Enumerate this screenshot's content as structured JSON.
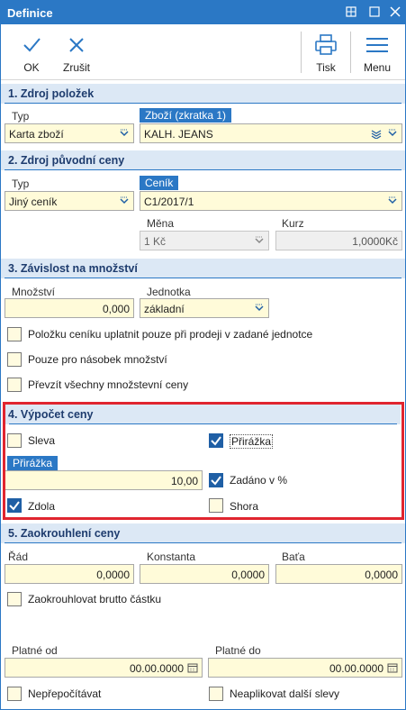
{
  "window": {
    "title": "Definice",
    "controls": [
      "restore",
      "close"
    ]
  },
  "toolbar": {
    "ok": "OK",
    "cancel": "Zrušit",
    "print": "Tisk",
    "menu": "Menu"
  },
  "s1": {
    "title": "1. Zdroj položek",
    "type_label": "Typ",
    "type_value": "Karta zboží",
    "goods_label": "Zboží (zkratka 1)",
    "goods_value": "KALH. JEANS"
  },
  "s2": {
    "title": "2. Zdroj původní ceny",
    "type_label": "Typ",
    "type_value": "Jiný ceník",
    "pricelist_label": "Ceník",
    "pricelist_value": "C1/2017/1",
    "currency_label": "Měna",
    "currency_value": "1 Kč",
    "rate_label": "Kurz",
    "rate_value": "1,0000",
    "rate_unit": "Kč"
  },
  "s3": {
    "title": "3. Závislost na množství",
    "qty_label": "Množství",
    "qty_value": "0,000",
    "unit_label": "Jednotka",
    "unit_value": "základní",
    "cb1": "Položku ceníku uplatnit pouze při prodeji v zadané jednotce",
    "cb2": "Pouze pro násobek množství",
    "cb3": "Převzít všechny množstevní ceny"
  },
  "s4": {
    "title": "4. Výpočet ceny",
    "discount": "Sleva",
    "discount_checked": false,
    "markup": "Přirážka",
    "markup_checked": true,
    "markup_field_label": "Přirážka",
    "markup_value": "10,00",
    "percent": "Zadáno v %",
    "percent_checked": true,
    "down": "Zdola",
    "down_checked": true,
    "up": "Shora",
    "up_checked": false
  },
  "s5": {
    "title": "5. Zaokrouhlení ceny",
    "order_label": "Řád",
    "order_value": "0,0000",
    "const_label": "Konstanta",
    "const_value": "0,0000",
    "bata_label": "Baťa",
    "bata_value": "0,0000",
    "gross": "Zaokrouhlovat brutto částku"
  },
  "validity": {
    "from_label": "Platné od",
    "from_value": "00.00.0000",
    "to_label": "Platné do",
    "to_value": "00.00.0000",
    "no_recalc": "Nepřepočítávat",
    "no_other_discounts": "Neaplikovat další slevy"
  },
  "colors": {
    "accent": "#2b78c5",
    "field_bg": "#fffbd9",
    "highlight": "#e0252f"
  }
}
